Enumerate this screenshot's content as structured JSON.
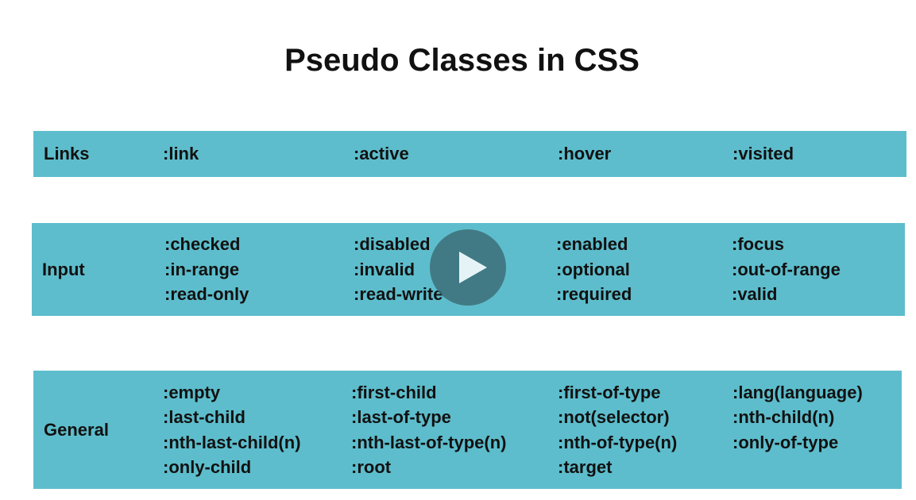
{
  "title": "Pseudo Classes in CSS",
  "colors": {
    "box": "#5dbdcc",
    "text": "#111111",
    "play_button": "#3c6e78"
  },
  "sections": [
    {
      "label": "Links",
      "columns": [
        [
          ":link"
        ],
        [
          ":active"
        ],
        [
          ":hover"
        ],
        [
          ":visited"
        ]
      ]
    },
    {
      "label": "Input",
      "columns": [
        [
          ":checked",
          ":in-range",
          ":read-only"
        ],
        [
          ":disabled",
          ":invalid",
          ":read-write"
        ],
        [
          ":enabled",
          ":optional",
          ":required"
        ],
        [
          ":focus",
          ":out-of-range",
          ":valid"
        ]
      ]
    },
    {
      "label": "General",
      "columns": [
        [
          ":empty",
          ":last-child",
          ":nth-last-child(n)",
          ":only-child"
        ],
        [
          ":first-child",
          ":last-of-type",
          ":nth-last-of-type(n)",
          ":root"
        ],
        [
          ":first-of-type",
          ":not(selector)",
          ":nth-of-type(n)",
          ":target"
        ],
        [
          ":lang(language)",
          ":nth-child(n)",
          ":only-of-type"
        ]
      ]
    }
  ],
  "video": {
    "play_icon": "play-icon"
  }
}
